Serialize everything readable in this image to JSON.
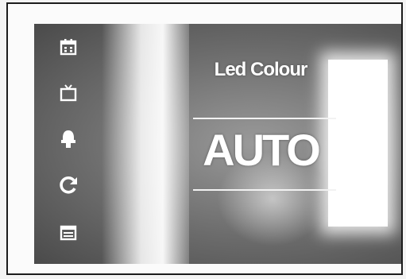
{
  "menu": {
    "title": "Led Colour",
    "value": "AUTO"
  },
  "sidebar": {
    "icons": [
      "calendar-icon",
      "tv-icon",
      "light-bulb-icon",
      "refresh-icon",
      "menu-list-icon"
    ],
    "selected": "light-bulb-icon"
  }
}
